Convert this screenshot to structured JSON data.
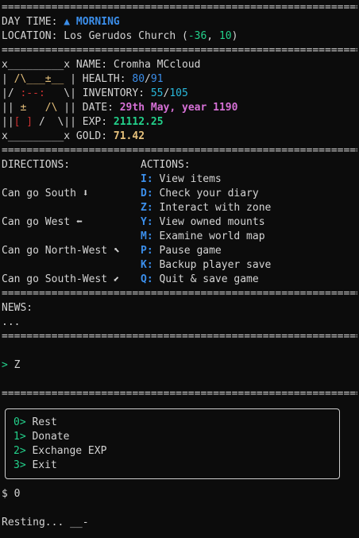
{
  "separator": "===============================================================",
  "header": {
    "day_time_label": "DAY TIME: ",
    "day_time_value": "▲ MORNING",
    "location_label": "LOCATION: Los Gerudos Church (",
    "coord_x": "-36",
    "coord_sep": ", ",
    "coord_y": "10",
    "coord_close": ")"
  },
  "art": {
    "row0": "x_________x",
    "row1_a": "| ",
    "row1_b": "/\\___±__",
    "row1_c": " |",
    "row2_a": "|/ ",
    "row2_b": ":--:",
    "row2_c": "   \\|",
    "row3_a": "|| ",
    "row3_b": "±   /\\",
    "row3_c": " ||",
    "row4_a": "||",
    "row4_b": "[ ]",
    "row4_c": " /  \\||",
    "row5": "x_________x"
  },
  "stats": {
    "name_label": "NAME: ",
    "name_value": "Cromha MCcloud",
    "health_label": "HEALTH: ",
    "health_current": "80",
    "health_sep": "/",
    "health_max": "91",
    "inventory_label": "INVENTORY: ",
    "inventory_current": "55",
    "inventory_sep": "/",
    "inventory_max": "105",
    "date_label": "DATE: ",
    "date_value": "29th May, year 1190",
    "exp_label": "EXP: ",
    "exp_value": "21112.25",
    "gold_label": "GOLD: ",
    "gold_value": "71.42"
  },
  "directions": {
    "title": "DIRECTIONS:",
    "items": [
      "Can go South ⬇",
      "Can go West ⬅",
      "Can go North-West ⬉",
      "Can go South-West ⬋"
    ]
  },
  "actions": {
    "title": "ACTIONS:",
    "items": [
      {
        "key": "I:",
        "label": " View items"
      },
      {
        "key": "D:",
        "label": " Check your diary"
      },
      {
        "key": "Z:",
        "label": " Interact with zone"
      },
      {
        "key": "Y:",
        "label": " View owned mounts"
      },
      {
        "key": "M:",
        "label": " Examine world map"
      },
      {
        "key": "P:",
        "label": " Pause game"
      },
      {
        "key": "K:",
        "label": " Backup player save"
      },
      {
        "key": "Q:",
        "label": " Quit & save game"
      }
    ]
  },
  "news": {
    "title": "NEWS:",
    "body": "..."
  },
  "prompt": {
    "symbol": ">",
    "input": " Z"
  },
  "menu": {
    "items": [
      {
        "key": "0>",
        "label": " Rest"
      },
      {
        "key": "1>",
        "label": " Donate"
      },
      {
        "key": "2>",
        "label": " Exchange EXP"
      },
      {
        "key": "3>",
        "label": " Exit"
      }
    ]
  },
  "choice": {
    "prompt": "$ 0"
  },
  "status": {
    "text": "Resting... __-"
  },
  "colors": {
    "background": "#0c0c0c",
    "blue": "#3b8eea",
    "cyan": "#29b8db",
    "green": "#23d18b",
    "magenta": "#d670d6",
    "yellow": "#e5c07b"
  }
}
